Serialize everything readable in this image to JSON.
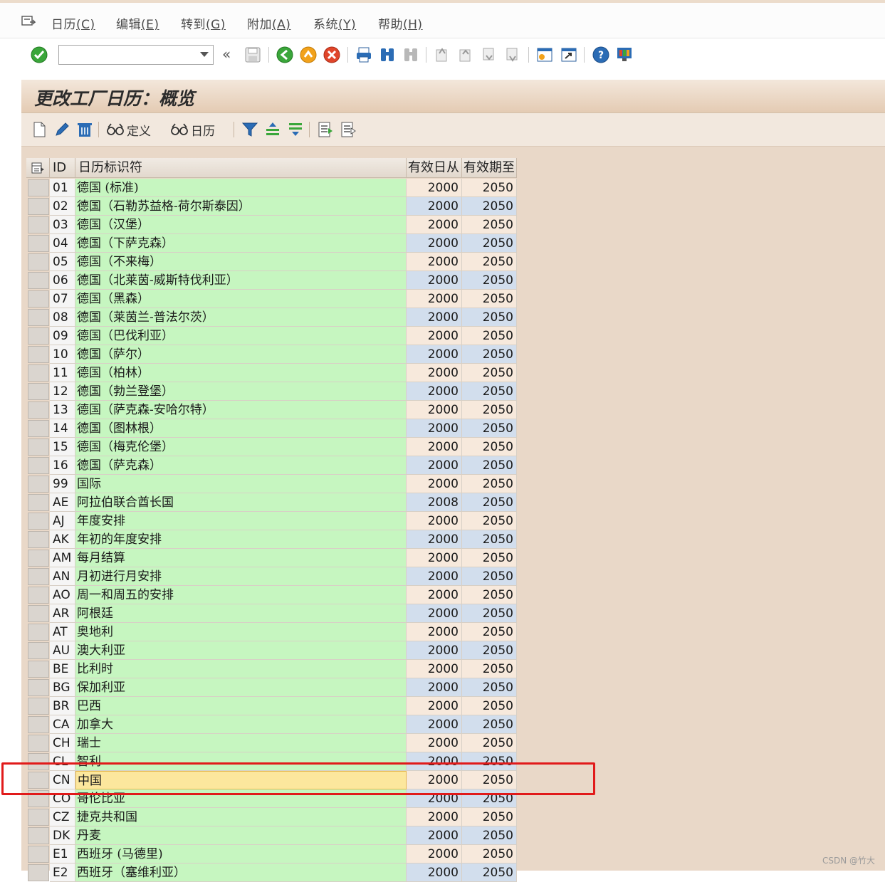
{
  "menubar": {
    "items": [
      {
        "label": "日历",
        "accel": "(C)"
      },
      {
        "label": "编辑",
        "accel": "(E)"
      },
      {
        "label": "转到",
        "accel": "(G)"
      },
      {
        "label": "附加",
        "accel": "(A)"
      },
      {
        "label": "系统",
        "accel": "(Y)"
      },
      {
        "label": "帮助",
        "accel": "(H)"
      }
    ]
  },
  "toolbar": {
    "command_value": "",
    "back_glyph": "«"
  },
  "title": "更改工厂日历：概览",
  "app_toolbar": {
    "define_label": "定义",
    "calendar_label": "日历"
  },
  "table": {
    "headers": {
      "id": "ID",
      "name": "日历标识符",
      "from": "有效日从",
      "to": "有效期至"
    },
    "rows": [
      {
        "id": "01",
        "name": "德国 (标准)",
        "from": "2000",
        "to": "2050"
      },
      {
        "id": "02",
        "name": "德国（石勒苏益格-荷尔斯泰因）",
        "from": "2000",
        "to": "2050"
      },
      {
        "id": "03",
        "name": "德国（汉堡）",
        "from": "2000",
        "to": "2050"
      },
      {
        "id": "04",
        "name": "德国（下萨克森）",
        "from": "2000",
        "to": "2050"
      },
      {
        "id": "05",
        "name": "德国（不来梅）",
        "from": "2000",
        "to": "2050"
      },
      {
        "id": "06",
        "name": "德国（北莱茵-威斯特伐利亚）",
        "from": "2000",
        "to": "2050"
      },
      {
        "id": "07",
        "name": "德国（黑森）",
        "from": "2000",
        "to": "2050"
      },
      {
        "id": "08",
        "name": "德国（莱茵兰-普法尔茨）",
        "from": "2000",
        "to": "2050"
      },
      {
        "id": "09",
        "name": "德国（巴伐利亚）",
        "from": "2000",
        "to": "2050"
      },
      {
        "id": "10",
        "name": "德国（萨尔）",
        "from": "2000",
        "to": "2050"
      },
      {
        "id": "11",
        "name": "德国（柏林）",
        "from": "2000",
        "to": "2050"
      },
      {
        "id": "12",
        "name": "德国（勃兰登堡）",
        "from": "2000",
        "to": "2050"
      },
      {
        "id": "13",
        "name": "德国（萨克森-安哈尔特）",
        "from": "2000",
        "to": "2050"
      },
      {
        "id": "14",
        "name": "德国（图林根）",
        "from": "2000",
        "to": "2050"
      },
      {
        "id": "15",
        "name": "德国（梅克伦堡）",
        "from": "2000",
        "to": "2050"
      },
      {
        "id": "16",
        "name": "德国（萨克森）",
        "from": "2000",
        "to": "2050"
      },
      {
        "id": "99",
        "name": "国际",
        "from": "2000",
        "to": "2050"
      },
      {
        "id": "AE",
        "name": "阿拉伯联合酋长国",
        "from": "2008",
        "to": "2050"
      },
      {
        "id": "AJ",
        "name": "年度安排",
        "from": "2000",
        "to": "2050"
      },
      {
        "id": "AK",
        "name": "年初的年度安排",
        "from": "2000",
        "to": "2050"
      },
      {
        "id": "AM",
        "name": "每月结算",
        "from": "2000",
        "to": "2050"
      },
      {
        "id": "AN",
        "name": "月初进行月安排",
        "from": "2000",
        "to": "2050"
      },
      {
        "id": "AO",
        "name": "周一和周五的安排",
        "from": "2000",
        "to": "2050"
      },
      {
        "id": "AR",
        "name": "阿根廷",
        "from": "2000",
        "to": "2050"
      },
      {
        "id": "AT",
        "name": "奥地利",
        "from": "2000",
        "to": "2050"
      },
      {
        "id": "AU",
        "name": "澳大利亚",
        "from": "2000",
        "to": "2050"
      },
      {
        "id": "BE",
        "name": "比利时",
        "from": "2000",
        "to": "2050"
      },
      {
        "id": "BG",
        "name": "保加利亚",
        "from": "2000",
        "to": "2050"
      },
      {
        "id": "BR",
        "name": "巴西",
        "from": "2000",
        "to": "2050"
      },
      {
        "id": "CA",
        "name": "加拿大",
        "from": "2000",
        "to": "2050"
      },
      {
        "id": "CH",
        "name": "瑞士",
        "from": "2000",
        "to": "2050"
      },
      {
        "id": "CL",
        "name": "智利",
        "from": "2000",
        "to": "2050"
      },
      {
        "id": "CN",
        "name": "中国",
        "from": "2000",
        "to": "2050",
        "focused": true
      },
      {
        "id": "CO",
        "name": "哥伦比亚",
        "from": "2000",
        "to": "2050"
      },
      {
        "id": "CZ",
        "name": "捷克共和国",
        "from": "2000",
        "to": "2050"
      },
      {
        "id": "DK",
        "name": "丹麦",
        "from": "2000",
        "to": "2050"
      },
      {
        "id": "E1",
        "name": "西班牙 (马德里)",
        "from": "2000",
        "to": "2050"
      },
      {
        "id": "E2",
        "name": "西班牙（塞维利亚）",
        "from": "2000",
        "to": "2050"
      }
    ]
  },
  "watermark": "CSDN @竹大",
  "colors": {
    "name_cell": "#c6f6c0",
    "focus_cell": "#fce79d",
    "highlight_box": "#e11a1a",
    "screen_bg": "#e9d8c8"
  }
}
